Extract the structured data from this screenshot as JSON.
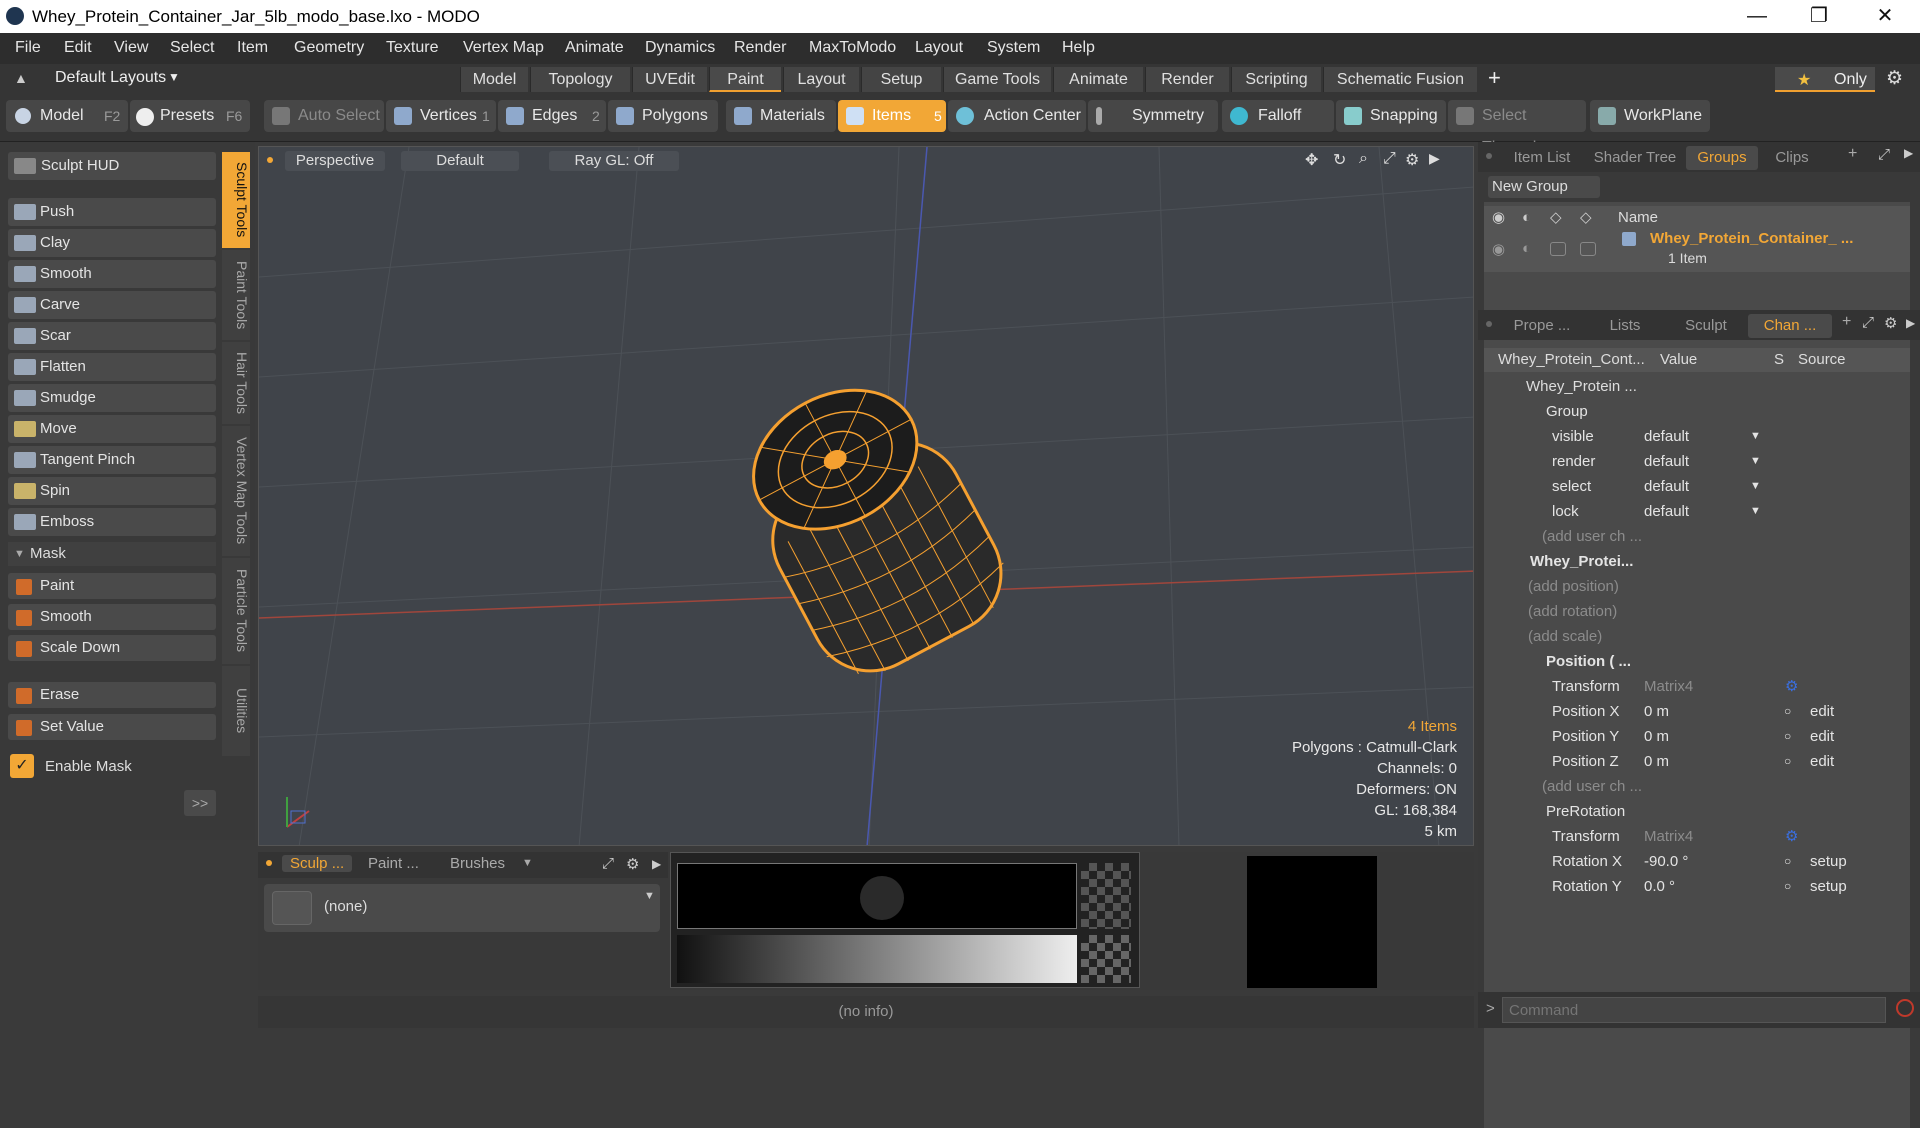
{
  "window": {
    "title": "Whey_Protein_Container_Jar_5lb_modo_base.lxo - MODO",
    "minimize": "—",
    "maximize": "❐",
    "close": "✕"
  },
  "menu": [
    "File",
    "Edit",
    "View",
    "Select",
    "Item",
    "Geometry",
    "Texture",
    "Vertex Map",
    "Animate",
    "Dynamics",
    "Render",
    "MaxToModo",
    "Layout",
    "System",
    "Help"
  ],
  "layout_bar": {
    "layouts_label": "Default Layouts",
    "tabs": [
      "Model",
      "Topology",
      "UVEdit",
      "Paint",
      "Layout",
      "Setup",
      "Game Tools",
      "Animate",
      "Render",
      "Scripting",
      "Schematic Fusion"
    ],
    "active_tab": "Paint",
    "add": "+",
    "only_label": "Only",
    "star": "★"
  },
  "toolbar": {
    "model": "Model",
    "model_key": "F2",
    "presets": "Presets",
    "presets_key": "F6",
    "auto_select": "Auto Select",
    "vertices": "Vertices",
    "vertices_count": "1",
    "edges": "Edges",
    "edges_count": "2",
    "polygons": "Polygons",
    "materials": "Materials",
    "items": "Items",
    "items_count": "5",
    "action_center": "Action Center",
    "symmetry": "Symmetry",
    "falloff": "Falloff",
    "snapping": "Snapping",
    "select_through": "Select Through",
    "workplane": "WorkPlane"
  },
  "left": {
    "hud": "Sculpt HUD",
    "tools": [
      "Push",
      "Clay",
      "Smooth",
      "Carve",
      "Scar",
      "Flatten",
      "Smudge",
      "Move",
      "Tangent Pinch",
      "Spin",
      "Emboss"
    ],
    "mask_header": "Mask",
    "mask_tools": [
      "Paint",
      "Smooth",
      "Scale Down"
    ],
    "erase": "Erase",
    "set_value": "Set Value",
    "enable_mask": "Enable Mask",
    "more": ">>",
    "vtabs": [
      "Sculpt Tools",
      "Paint Tools",
      "Hair Tools",
      "Vertex Map Tools",
      "Particle Tools",
      "Utilities"
    ]
  },
  "viewport": {
    "view": "Perspective",
    "shading": "Default",
    "raygl": "Ray GL: Off",
    "info": {
      "items": "4 Items",
      "polygons": "Polygons : Catmull-Clark",
      "channels": "Channels: 0",
      "deformers": "Deformers: ON",
      "gl": "GL: 168,384",
      "scale": "5 km"
    }
  },
  "bottom": {
    "tabs": [
      "Sculp ...",
      "Paint ...",
      "Brushes"
    ],
    "brush": "(none)"
  },
  "status": "(no info)",
  "right": {
    "top_tabs": [
      "Item List",
      "Shader Tree",
      "Groups",
      "Clips"
    ],
    "active_top": "Groups",
    "new_group": "New Group",
    "name_col": "Name",
    "group_name": "Whey_Protein_Container_ ...",
    "group_count": "1 Item",
    "bottom_tabs": [
      "Prope ...",
      "Lists",
      "Sculpt",
      "Chan ..."
    ],
    "active_bottom": "Chan ...",
    "columns": {
      "name": "Whey_Protein_Cont...",
      "value": "Value",
      "s": "S",
      "source": "Source"
    },
    "rows": [
      {
        "name": "Whey_Protein ...",
        "value": "",
        "source": ""
      },
      {
        "name": "Group",
        "value": "",
        "source": ""
      },
      {
        "name": "visible",
        "value": "default",
        "source": ""
      },
      {
        "name": "render",
        "value": "default",
        "source": ""
      },
      {
        "name": "select",
        "value": "default",
        "source": ""
      },
      {
        "name": "lock",
        "value": "default",
        "source": ""
      },
      {
        "name": "(add user ch ...",
        "value": "",
        "source": ""
      },
      {
        "name": "Whey_Protei...",
        "value": "",
        "source": ""
      },
      {
        "name": "(add position)",
        "value": "",
        "source": ""
      },
      {
        "name": "(add rotation)",
        "value": "",
        "source": ""
      },
      {
        "name": "(add scale)",
        "value": "",
        "source": ""
      },
      {
        "name": "Position ( ...",
        "value": "",
        "source": ""
      },
      {
        "name": "Transform",
        "value": "Matrix4",
        "source": ""
      },
      {
        "name": "Position X",
        "value": "0 m",
        "source": "edit"
      },
      {
        "name": "Position Y",
        "value": "0 m",
        "source": "edit"
      },
      {
        "name": "Position Z",
        "value": "0 m",
        "source": "edit"
      },
      {
        "name": "(add user ch ...",
        "value": "",
        "source": ""
      },
      {
        "name": "PreRotation",
        "value": "",
        "source": ""
      },
      {
        "name": "Transform",
        "value": "Matrix4",
        "source": ""
      },
      {
        "name": "Rotation X",
        "value": "-90.0 °",
        "source": "setup"
      },
      {
        "name": "Rotation Y",
        "value": "0.0 °",
        "source": "setup"
      }
    ],
    "command_placeholder": "Command"
  },
  "colors": {
    "accent": "#f2a736",
    "panel": "#393939",
    "viewport_bg": "#40444a",
    "wire": "#f5a030"
  }
}
